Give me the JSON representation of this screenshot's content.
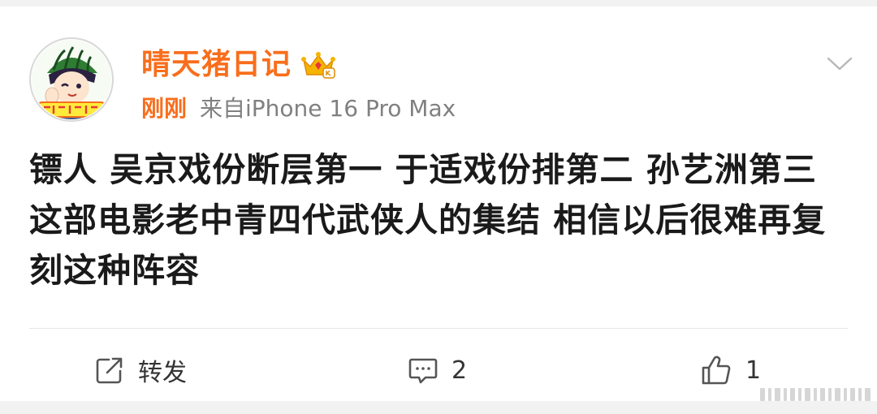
{
  "post": {
    "username": "晴天猪日记",
    "time": "刚刚",
    "source": "来自iPhone 16 Pro Max",
    "content": "镖人 吴京戏份断层第一 于适戏份排第二 孙艺洲第三 这部电影老中青四代武侠人的集结 相信以后很难再复刻这种阵容"
  },
  "actions": {
    "repost_label": "转发",
    "comment_count": "2",
    "like_count": "1"
  },
  "icons": {
    "avatar": "user-avatar",
    "badge": "vip-crown-icon",
    "more": "chevron-down-icon",
    "repost": "repost-icon",
    "comment": "comment-icon",
    "like": "thumbs-up-icon"
  },
  "colors": {
    "username": "#f86e1c",
    "time": "#f86e1c",
    "meta": "#808080",
    "text": "#1a1a1a",
    "background": "#ffffff"
  }
}
